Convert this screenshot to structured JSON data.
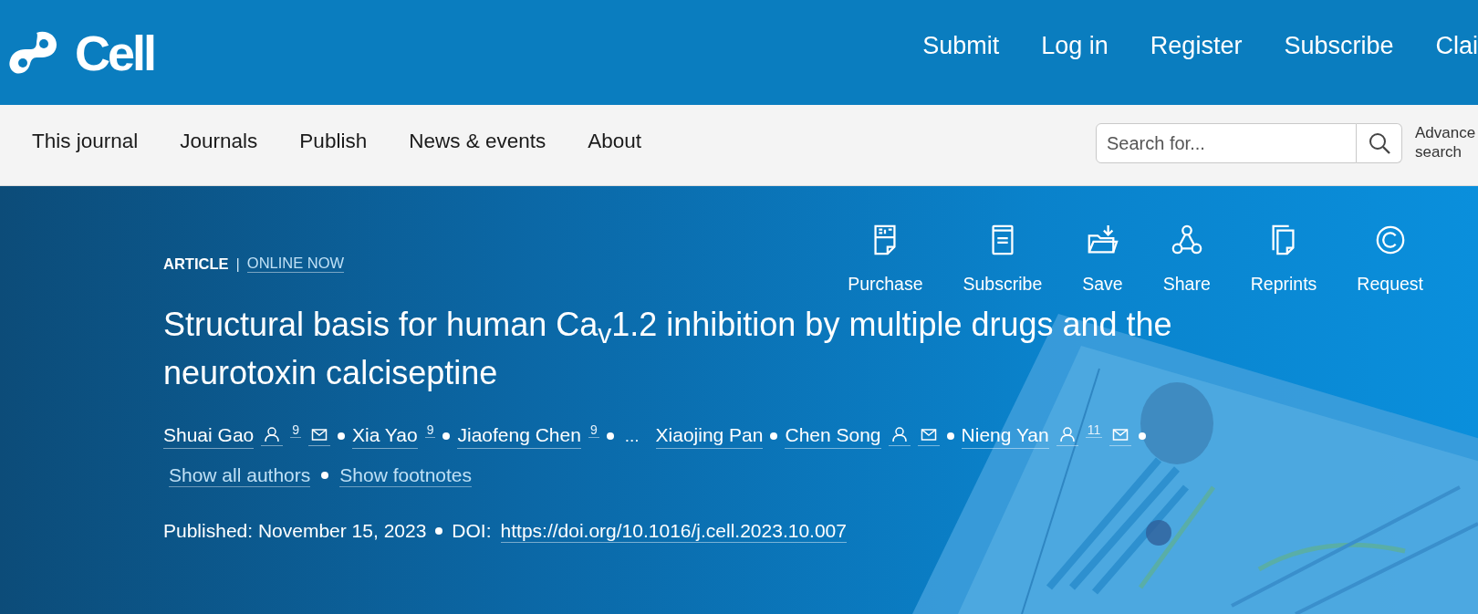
{
  "top_bar": {
    "logo": "Cell",
    "links": [
      {
        "label": "Submit"
      },
      {
        "label": "Log in"
      },
      {
        "label": "Register"
      },
      {
        "label": "Subscribe"
      },
      {
        "label": "Clai"
      }
    ]
  },
  "nav": {
    "items": [
      {
        "label": "This journal"
      },
      {
        "label": "Journals"
      },
      {
        "label": "Publish"
      },
      {
        "label": "News & events"
      },
      {
        "label": "About"
      }
    ],
    "search": {
      "placeholder": "Search for..."
    },
    "advanced_search": "Advance search"
  },
  "article": {
    "type": "ARTICLE",
    "type_separator": "|",
    "status": "ONLINE NOW",
    "actions": [
      {
        "kind": "pdf",
        "label": "Purchase"
      },
      {
        "kind": "book",
        "label": "Subscribe"
      },
      {
        "kind": "folder",
        "label": "Save"
      },
      {
        "kind": "share",
        "label": "Share"
      },
      {
        "kind": "copies",
        "label": "Reprints"
      },
      {
        "kind": "copyright",
        "label": "Request"
      }
    ],
    "title": "Structural basis for human Ca$_{v}$1.2 inhibition by multiple drugs and the neurotoxin calciseptine",
    "authors": [
      {
        "kind": "author",
        "name": "Shuai Gao",
        "profile": true,
        "note": "9",
        "email": true,
        "bullet_after": true
      },
      {
        "kind": "author",
        "name": "Xia Yao",
        "profile": false,
        "note": "9",
        "email": false,
        "bullet_after": true
      },
      {
        "kind": "author",
        "name": "Jiaofeng Chen",
        "profile": false,
        "note": "9",
        "email": false,
        "bullet_after": true
      },
      {
        "kind": "ellipsis",
        "name": "...",
        "bullet_after": false
      },
      {
        "kind": "author",
        "name": "Xiaojing Pan",
        "profile": false,
        "email": false,
        "bullet_after": true
      },
      {
        "kind": "author",
        "name": "Chen Song",
        "profile": true,
        "email": true,
        "bullet_after": true
      },
      {
        "kind": "author",
        "name": "Nieng Yan",
        "profile": true,
        "note": "11",
        "email": true,
        "bullet_after": true
      }
    ],
    "show_links": [
      "Show all authors",
      "Show footnotes"
    ],
    "published": "Published: November 15, 2023",
    "doi_label": "DOI:",
    "doi": "https://doi.org/10.1016/j.cell.2023.10.007"
  }
}
